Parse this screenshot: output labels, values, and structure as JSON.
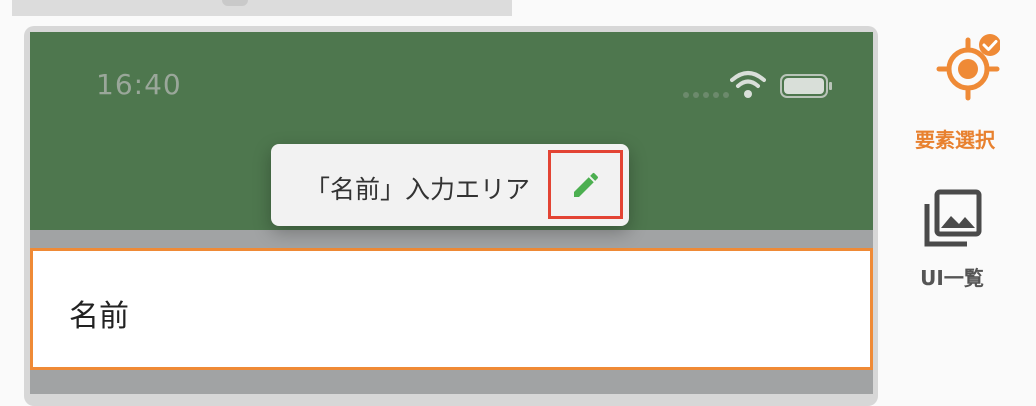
{
  "status_bar": {
    "time": "16:40"
  },
  "tooltip": {
    "label": "「名前」入力エリア",
    "edit_icon": "pencil-icon"
  },
  "field": {
    "label": "名前"
  },
  "sidebar": {
    "items": [
      {
        "label": "要素選択",
        "icon": "target-check-icon",
        "active": true
      },
      {
        "label": "UI一覧",
        "icon": "image-gallery-icon",
        "active": false
      }
    ]
  },
  "colors": {
    "header_green": "#4e774e",
    "accent_orange": "#ef8a36",
    "highlight_red": "#e34434",
    "pencil_green": "#4caf50"
  }
}
